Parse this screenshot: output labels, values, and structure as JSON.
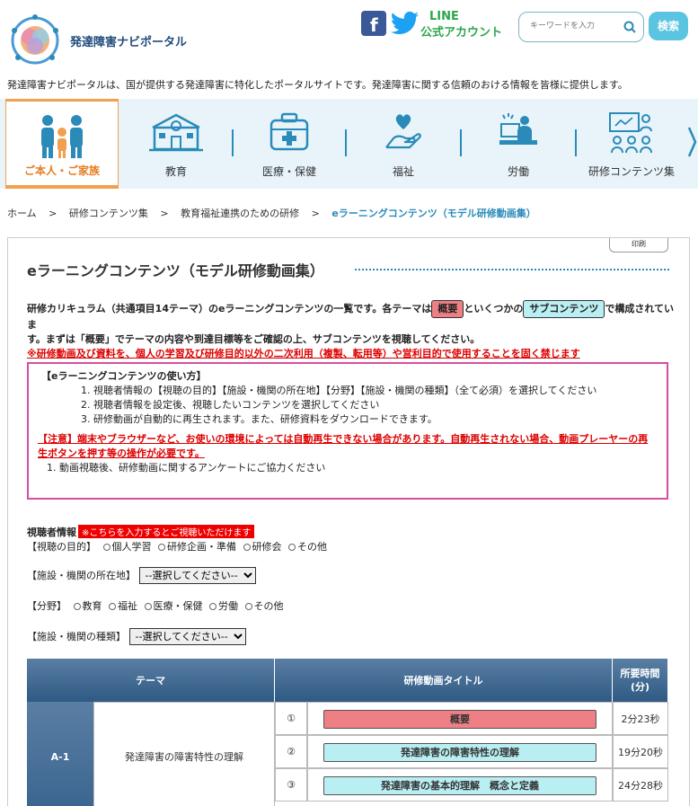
{
  "header": {
    "site_name": "発達障害ナビポータル",
    "line_label": "LINE",
    "official_account": "公式アカウント",
    "search_placeholder": "キーワードを入力",
    "search_button": "検索",
    "tagline": "発達障害ナビポータルは、国が提供する発達障害に特化したポータルサイトです。発達障害に関する信頼のおける情報を皆様に提供します。"
  },
  "nav": {
    "items": [
      {
        "label": "ご本人・ご家族",
        "icon": "family-icon"
      },
      {
        "label": "教育",
        "icon": "school-icon"
      },
      {
        "label": "医療・保健",
        "icon": "medical-icon"
      },
      {
        "label": "福祉",
        "icon": "welfare-icon"
      },
      {
        "label": "労働",
        "icon": "work-icon"
      },
      {
        "label": "研修コンテンツ集",
        "icon": "training-icon"
      }
    ]
  },
  "breadcrumb": [
    "ホーム",
    ">",
    "研修コンテンツ集",
    ">",
    "教育福祉連携のための研修",
    ">",
    "eラーニングコンテンツ（モデル研修動画集）"
  ],
  "print_label": "印刷",
  "page_title": "eラーニングコンテンツ（モデル研修動画集）",
  "intro": {
    "line1_a": "研修カリキュラム（共通項目14テーマ）のeラーニングコンテンツの一覧です。各テーマは",
    "pill_overview": "概要",
    "line1_b": "といくつかの",
    "pill_sub": "サブコンテンツ",
    "line1_c": "で構成されていま",
    "line2": "す。まずは「概要」でテーマの内容や到達目標等をご確認の上、サブコンテンツを視聴してください。",
    "warning": "※研修動画及び資料を、個人の学習及び研修目的以外の二次利用（複製、転用等）や営利目的で使用することを固く禁じます"
  },
  "howto": {
    "heading": "【eラーニングコンテンツの使い方】",
    "steps": [
      "1. 視聴者情報の【視聴の目的】【施設・機関の所在地】【分野】【施設・機関の種類】（全て必須）を選択してください",
      "2. 視聴者情報を設定後、視聴したいコンテンツを選択してください",
      "3. 研修動画が自動的に再生されます。また、研修資料をダウンロードできます。"
    ],
    "note": "【注意】端末やブラウザーなど、お使いの環境によっては自動再生できない場合があります。自動再生されない場合、動画プレーヤーの再生ボタンを押す等の操作が必要です。",
    "survey": "1. 動画視聴後、研修動画に関するアンケートにご協力ください"
  },
  "form": {
    "viewer_label": "視聴者情報",
    "required_badge": "※こちらを入力するとご視聴いただけます",
    "purpose_label": "【視聴の目的】",
    "purpose_options": [
      "個人学習",
      "研修企画・準備",
      "研修会",
      "その他"
    ],
    "location_label": "【施設・機関の所在地】",
    "select_default": "--選択してください--",
    "field_label": "【分野】",
    "field_options": [
      "教育",
      "福祉",
      "医療・保健",
      "労働",
      "その他"
    ],
    "type_label": "【施設・機関の種類】"
  },
  "table": {
    "headers": [
      "テーマ",
      "研修動画タイトル",
      "所要時間\n(分)"
    ],
    "code": "A-1",
    "theme": "発達障害の障害特性の理解",
    "rows": [
      {
        "num": "①",
        "title": "概要",
        "time": "2分23秒",
        "kind": "overview"
      },
      {
        "num": "②",
        "title": "発達障害の障害特性の理解",
        "time": "19分20秒",
        "kind": "sub"
      },
      {
        "num": "③",
        "title": "発達障害の基本的理解　概念と定義",
        "time": "24分28秒",
        "kind": "sub"
      }
    ]
  }
}
